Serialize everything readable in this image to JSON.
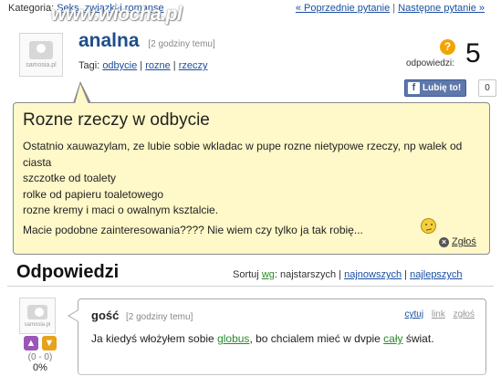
{
  "topbar": {
    "category_label": "Kategoria:",
    "category_link": "Seks, związki i romanse",
    "prev_link": "« Poprzednie pytanie",
    "separator": "|",
    "next_link": "Następne pytanie »"
  },
  "watermark": "www.wiocha.pl",
  "question": {
    "avatar_brand": "samosia.pl",
    "title": "analna",
    "time": "[2 godziny temu]",
    "tags_label": "Tagi:",
    "tags": [
      "odbycie",
      "rozne",
      "rzeczy"
    ],
    "answers_label": "odpowiedzi:",
    "answers_count": "5",
    "answers_icon": "question-mark-icon",
    "like_label": "Lubię to!",
    "like_count": "0",
    "heading": "Rozne rzeczy w odbycie",
    "body_lines": [
      "Ostatnio xauwazylam, ze lubie sobie wkladac w pupe rozne nietypowe rzeczy, np walek od ciasta",
      "szczotke od toalety",
      "rolke od papieru toaletowego",
      "rozne kremy i maci o owalnym ksztalcie."
    ],
    "last_line": "Macie podobne zainteresowania???? Nie wiem czy tylko ja tak robię...",
    "report_label": "Zgłoś"
  },
  "answers": {
    "title": "Odpowiedzi",
    "sort_label": "Sortuj",
    "sort_wg": "wg",
    "sort_current": ": najstarszych |",
    "sort_newest": "najnowszych",
    "sort_sep": "|",
    "sort_best": "najlepszych",
    "items": [
      {
        "avatar_brand": "samosia.pl",
        "author": "gość",
        "time": "[2 godziny temu]",
        "actions": [
          "cytuj",
          "link",
          "zgłoś"
        ],
        "text_before": "Ja kiedyś włożyłem sobie ",
        "highlight1": "globus",
        "text_middle": ", bo chcialem mieć w dvpie ",
        "highlight2": "cały",
        "text_after": " świat.",
        "votes": "(0 - 0)",
        "percent": "0%"
      }
    ]
  }
}
